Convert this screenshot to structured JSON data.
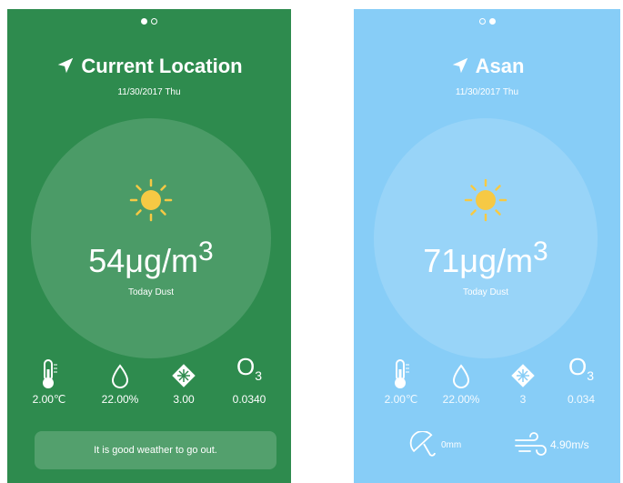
{
  "screens": [
    {
      "title": "Current Location",
      "date": "11/30/2017 Thu",
      "dust_value": "54μg/m",
      "dust_sup": "3",
      "dust_label": "Today Dust",
      "stats": {
        "temperature": "2.00℃",
        "humidity": "22.00%",
        "index": "3.00",
        "ozone": "0.0340"
      },
      "message": "It is good weather to go out.",
      "background": "#2e8b4e",
      "pager_active": 0
    },
    {
      "title": "Asan",
      "date": "11/30/2017 Thu",
      "dust_value": "71μg/m",
      "dust_sup": "3",
      "dust_label": "Today Dust",
      "stats": {
        "temperature": "2.00℃",
        "humidity": "22.00%",
        "index": "3",
        "ozone": "0.034"
      },
      "rain": "0mm",
      "wind": "4.90m/s",
      "background": "#87cdf7",
      "pager_active": 1
    }
  ],
  "icons": {
    "location": "navigation-arrow-icon",
    "weather": "sun-icon",
    "temperature": "thermometer-icon",
    "humidity": "water-drop-icon",
    "index": "snowflake-icon",
    "ozone": "ozone-icon",
    "rain": "umbrella-icon",
    "wind": "wind-icon"
  },
  "ozone_symbol": "O",
  "ozone_sub": "3",
  "sun_color": "#f6c944"
}
